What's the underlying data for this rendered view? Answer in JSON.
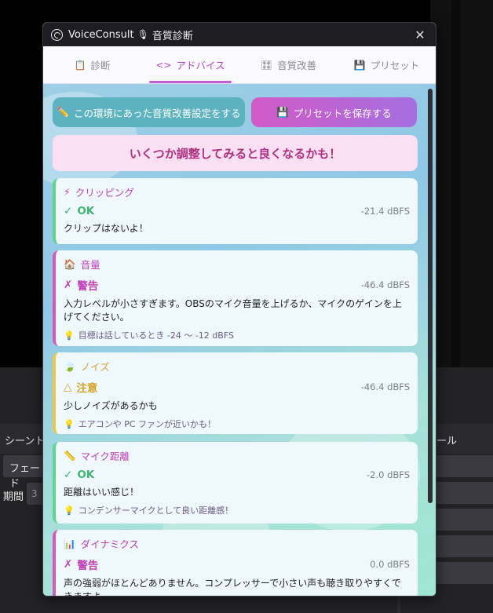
{
  "obs": {
    "scene_transition_label": "シーントラ",
    "right_dock_label": "ール",
    "fade_value": "フェード",
    "duration_label": "期間",
    "duration_value": "3"
  },
  "window": {
    "title_app": "VoiceConsult",
    "title_mic": "🎙",
    "title_sub": "音質診断",
    "close_glyph": "✕"
  },
  "tabs": [
    {
      "icon": "📋",
      "label": "診断"
    },
    {
      "icon": "<>",
      "label": "アドバイス"
    },
    {
      "icon": "🎛",
      "label": "音質改善"
    },
    {
      "icon": "💾",
      "label": "プリセット"
    }
  ],
  "actions": {
    "tune_icon": "✏️",
    "tune_label": "この環境にあった音質改善設定をする",
    "save_icon": "💾",
    "save_label": "プリセットを保存する"
  },
  "banner": "いくつか調整してみると良くなるかも！",
  "cards": [
    {
      "icon": "⚡",
      "title": "クリッピング",
      "status_icon": "✓",
      "status": "OK",
      "dbfs": "-21.4 dBFS",
      "message": "クリップはないよ！",
      "tip_icon": "",
      "tip": ""
    },
    {
      "icon": "🏠",
      "title": "音量",
      "status_icon": "✗",
      "status": "警告",
      "dbfs": "-46.4 dBFS",
      "message": "入力レベルが小さすぎます。OBSのマイク音量を上げるか、マイクのゲインを上げてください。",
      "tip_icon": "💡",
      "tip": "目標は話しているとき -24 〜 -12 dBFS"
    },
    {
      "icon": "🍃",
      "title": "ノイズ",
      "status_icon": "△",
      "status": "注意",
      "dbfs": "-46.4 dBFS",
      "message": "少しノイズがあるかも",
      "tip_icon": "💡",
      "tip": "エアコンや PC ファンが近いかも！"
    },
    {
      "icon": "📏",
      "title": "マイク距離",
      "status_icon": "✓",
      "status": "OK",
      "dbfs": "-2.0 dBFS",
      "message": "距離はいい感じ！",
      "tip_icon": "💡",
      "tip": "コンデンサーマイクとして良い距離感！"
    },
    {
      "icon": "📊",
      "title": "ダイナミクス",
      "status_icon": "✗",
      "status": "警告",
      "dbfs": "0.0 dBFS",
      "message": "声の強弱がほとんどありません。コンプレッサーで小さい声も聴き取りやすくできますよ。",
      "tip_icon": "",
      "tip": ""
    }
  ],
  "colors": {
    "ok": "#3fb56e",
    "warning": "#c040b8",
    "caution": "#d6a32a",
    "accent": "#c45cd6"
  }
}
